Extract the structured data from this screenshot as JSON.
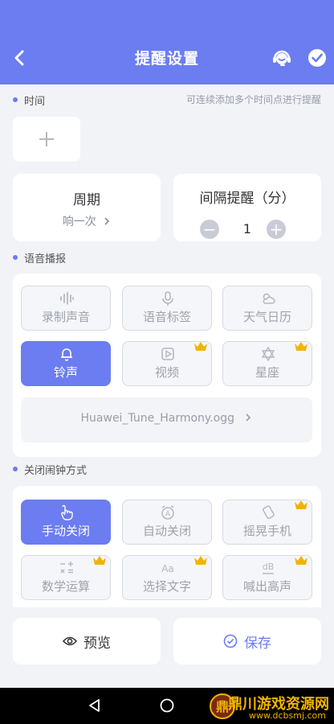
{
  "header": {
    "title": "提醒设置"
  },
  "time_section": {
    "title": "时间",
    "hint": "可连续添加多个时间点进行提醒"
  },
  "cycle_card": {
    "title": "周期",
    "value": "响一次"
  },
  "interval_card": {
    "title": "间隔提醒（分）",
    "value": "1"
  },
  "voice_section": {
    "title": "语音播报",
    "buttons": [
      {
        "label": "录制声音",
        "icon": "waveform-icon",
        "active": false,
        "premium": false
      },
      {
        "label": "语音标签",
        "icon": "microphone-icon",
        "active": false,
        "premium": false
      },
      {
        "label": "天气日历",
        "icon": "weather-icon",
        "active": false,
        "premium": false
      },
      {
        "label": "铃声",
        "icon": "bell-icon",
        "active": true,
        "premium": false
      },
      {
        "label": "视频",
        "icon": "video-icon",
        "active": false,
        "premium": true
      },
      {
        "label": "星座",
        "icon": "star-of-david-icon",
        "active": false,
        "premium": true
      }
    ],
    "file": "Huawei_Tune_Harmony.ogg"
  },
  "close_section": {
    "title": "关闭闹钟方式",
    "buttons": [
      {
        "label": "手动关闭",
        "icon": "hand-pointer-icon",
        "active": true,
        "premium": false
      },
      {
        "label": "自动关闭",
        "icon": "auto-alarm-icon",
        "active": false,
        "premium": false
      },
      {
        "label": "摇晃手机",
        "icon": "shake-phone-icon",
        "active": false,
        "premium": true
      },
      {
        "label": "数学运算",
        "icon": "math-icon",
        "active": false,
        "premium": true
      },
      {
        "label": "选择文字",
        "icon": "text-aa-icon",
        "active": false,
        "premium": true
      },
      {
        "label": "喊出高声",
        "icon": "decibel-icon",
        "active": false,
        "premium": true
      }
    ]
  },
  "footer": {
    "preview_label": "预览",
    "save_label": "保存"
  },
  "watermark": {
    "text": "鼎川游戏资源网",
    "url": "www.dcbsmj.com"
  },
  "colors": {
    "accent": "#6b7df0",
    "premium": "#f0b400"
  }
}
